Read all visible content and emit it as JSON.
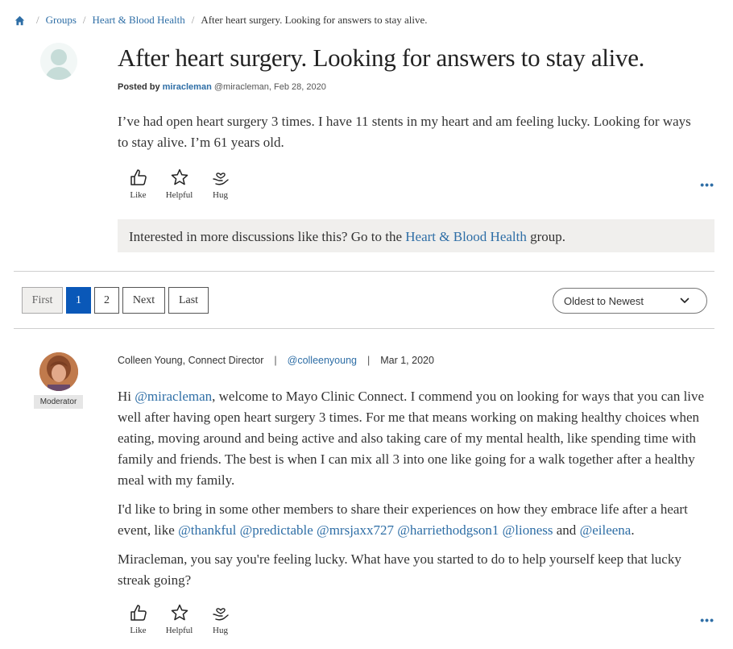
{
  "breadcrumb": {
    "home_icon": "home-icon",
    "items": [
      "Groups",
      "Heart & Blood Health"
    ],
    "current": "After heart surgery. Looking for answers to stay alive."
  },
  "post": {
    "title": "After heart surgery. Looking for answers to stay alive.",
    "posted_by_label": "Posted by",
    "author": "miracleman",
    "handle_date": "@miracleman, Feb 28, 2020",
    "body": "I’ve had open heart surgery 3 times. I have 11 stents in my heart and am feeling lucky. Looking for ways to stay alive. I’m 61 years old.",
    "reactions": [
      {
        "label": "Like",
        "icon": "thumbs-up-icon"
      },
      {
        "label": "Helpful",
        "icon": "star-icon"
      },
      {
        "label": "Hug",
        "icon": "hug-icon"
      }
    ],
    "more": "•••"
  },
  "banner": {
    "prefix": "Interested in more discussions like this? Go to the",
    "link": "Heart & Blood Health",
    "suffix": "group."
  },
  "pagination": {
    "first": "First",
    "pages": [
      "1",
      "2"
    ],
    "active_page": "1",
    "next": "Next",
    "last": "Last"
  },
  "sort": {
    "selected": "Oldest to Newest",
    "icon": "chevron-down-icon"
  },
  "reply": {
    "author_line": "Colleen Young, Connect Director",
    "handle": "@colleenyoung",
    "date": "Mar 1, 2020",
    "badge": "Moderator",
    "p1_pre": "Hi",
    "p1_mention": "@miracleman",
    "p1_post": ", welcome to Mayo Clinic Connect. I commend you on looking for ways that you can live well after having open heart surgery 3 times. For me that means working on making healthy choices when eating, moving around and being active and also taking care of my mental health, like spending time with family and friends. The best is when I can mix all 3 into one like going for a walk together after a healthy meal with my family.",
    "p2_pre": "I'd like to bring in some other members to share their experiences on how they embrace life after a heart event, like",
    "p2_mentions": [
      "@thankful",
      "@predictable",
      "@mrsjaxx727",
      "@harriethodgson1",
      "@lioness"
    ],
    "p2_and": "and",
    "p2_last": "@eileena",
    "p2_end": ".",
    "p3": "Miracleman, you say you're feeling lucky. What have you started to do to help yourself keep that lucky streak going?",
    "reactions": [
      {
        "label": "Like",
        "icon": "thumbs-up-icon"
      },
      {
        "label": "Helpful",
        "icon": "star-icon"
      },
      {
        "label": "Hug",
        "icon": "hug-icon"
      }
    ],
    "more": "•••"
  },
  "colors": {
    "link": "#2e6ea6",
    "active_page": "#0a58b8",
    "banner_bg": "#f0efed"
  }
}
